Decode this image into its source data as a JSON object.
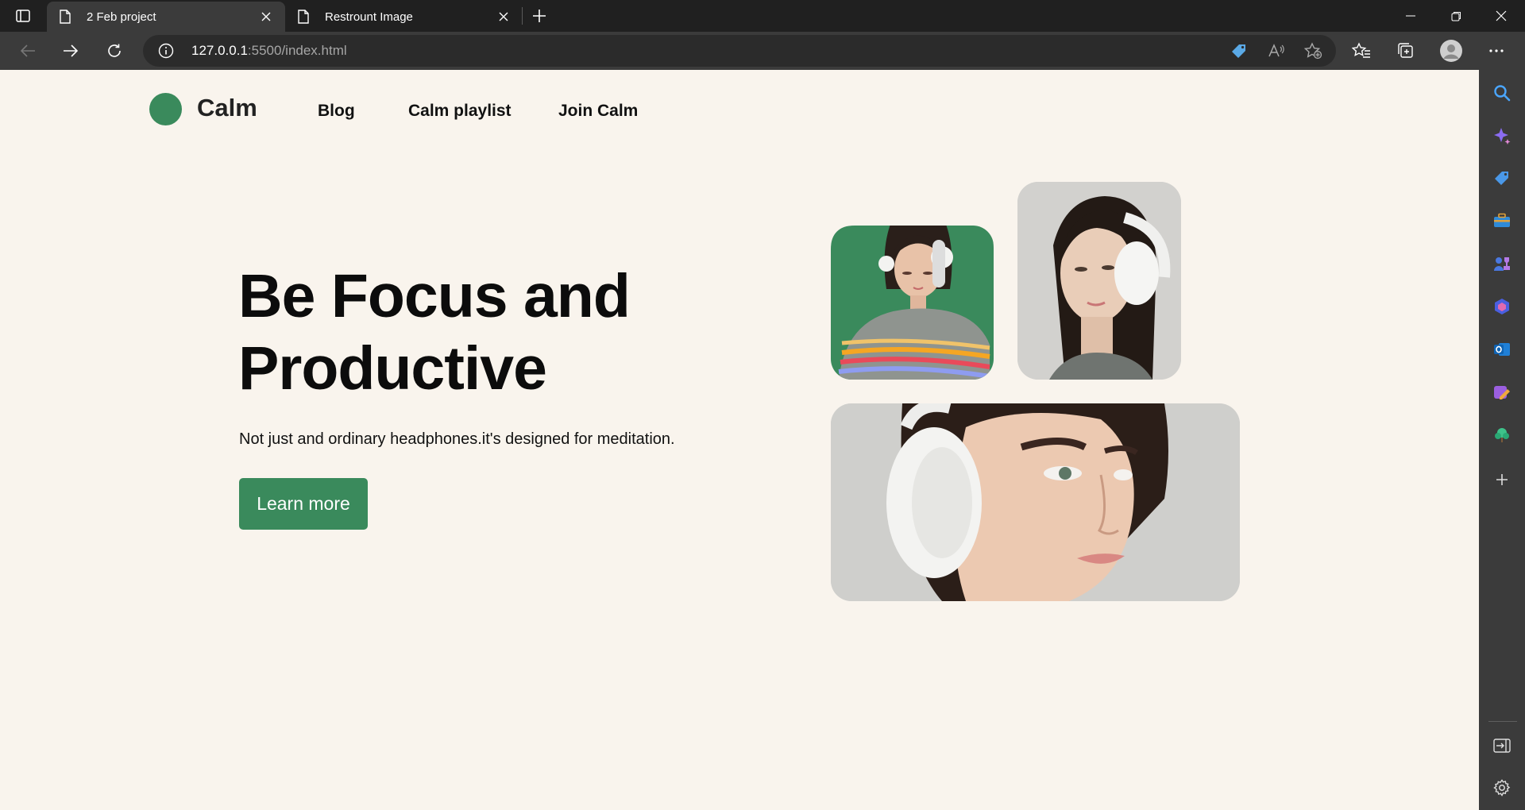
{
  "browser": {
    "tabs": [
      {
        "title": "2 Feb project",
        "active": true
      },
      {
        "title": "Restrount Image",
        "active": false
      }
    ],
    "url_host": "127.0.0.1",
    "url_rest": ":5500/index.html"
  },
  "site": {
    "brand": "Calm",
    "nav": [
      "Blog",
      "Calm playlist",
      "Join Calm"
    ],
    "hero_title_line1": "Be Focus and",
    "hero_title_line2": "Productive",
    "hero_subtitle": "Not just and ordinary headphones.it's designed for meditation.",
    "cta_label": "Learn more"
  },
  "colors": {
    "brand_green": "#3a8a5c",
    "page_bg": "#f9f4ed",
    "chrome_dark": "#202020",
    "chrome_toolbar": "#3b3b3b"
  }
}
